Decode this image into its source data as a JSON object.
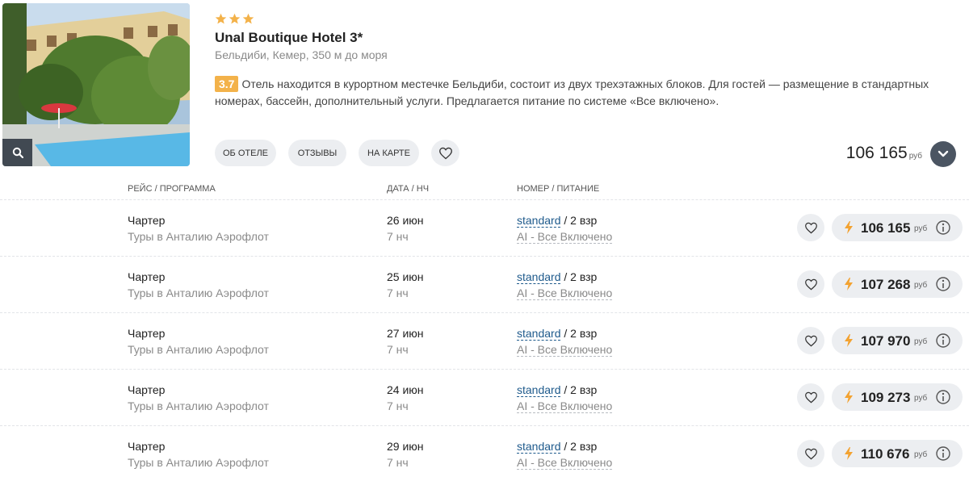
{
  "hotel": {
    "name": "Unal Boutique Hotel 3*",
    "stars": 3,
    "location": "Бельдиби, Кемер, 350 м до моря",
    "rating": "3.7",
    "description": "Отель находится в курортном местечке Бельдиби, состоит из двух трехэтажных блоков. Для гостей — размещение в стандартных номерах, бассейн, дополнительный услуги. Предлагается питание по системе «Все включено».",
    "buttons": {
      "about": "Об отеле",
      "reviews": "Отзывы",
      "map": "На карте"
    },
    "min_price": "106 165",
    "currency": "руб"
  },
  "table": {
    "headers": {
      "flight": "Рейс / программа",
      "date": "Дата / нч",
      "room": "Номер / питание"
    },
    "rows": [
      {
        "title": "Чартер",
        "program": "Туры в Анталию Аэрофлот",
        "date": "26 июн",
        "nights": "7 нч",
        "room": "standard",
        "guests": "/ 2 взр",
        "meal": "AI - Все Включено",
        "price": "106 165",
        "currency": "руб"
      },
      {
        "title": "Чартер",
        "program": "Туры в Анталию Аэрофлот",
        "date": "25 июн",
        "nights": "7 нч",
        "room": "standard",
        "guests": "/ 2 взр",
        "meal": "AI - Все Включено",
        "price": "107 268",
        "currency": "руб"
      },
      {
        "title": "Чартер",
        "program": "Туры в Анталию Аэрофлот",
        "date": "27 июн",
        "nights": "7 нч",
        "room": "standard",
        "guests": "/ 2 взр",
        "meal": "AI - Все Включено",
        "price": "107 970",
        "currency": "руб"
      },
      {
        "title": "Чартер",
        "program": "Туры в Анталию Аэрофлот",
        "date": "24 июн",
        "nights": "7 нч",
        "room": "standard",
        "guests": "/ 2 взр",
        "meal": "AI - Все Включено",
        "price": "109 273",
        "currency": "руб"
      },
      {
        "title": "Чартер",
        "program": "Туры в Анталию Аэрофлот",
        "date": "29 июн",
        "nights": "7 нч",
        "room": "standard",
        "guests": "/ 2 взр",
        "meal": "AI - Все Включено",
        "price": "110 676",
        "currency": "руб"
      }
    ]
  },
  "icons": {
    "star": "star-icon",
    "zoom": "search-icon",
    "favorite": "heart-icon",
    "expand": "chevron-down-icon",
    "hot_price": "lightning-icon",
    "info": "info-icon"
  },
  "colors": {
    "star": "#f3b24a",
    "rating_badge": "#f3b24a",
    "link": "#1e5a8c",
    "pill_bg": "#eceef1",
    "expand_bg": "#4b5562",
    "bolt": "#f3a230"
  }
}
